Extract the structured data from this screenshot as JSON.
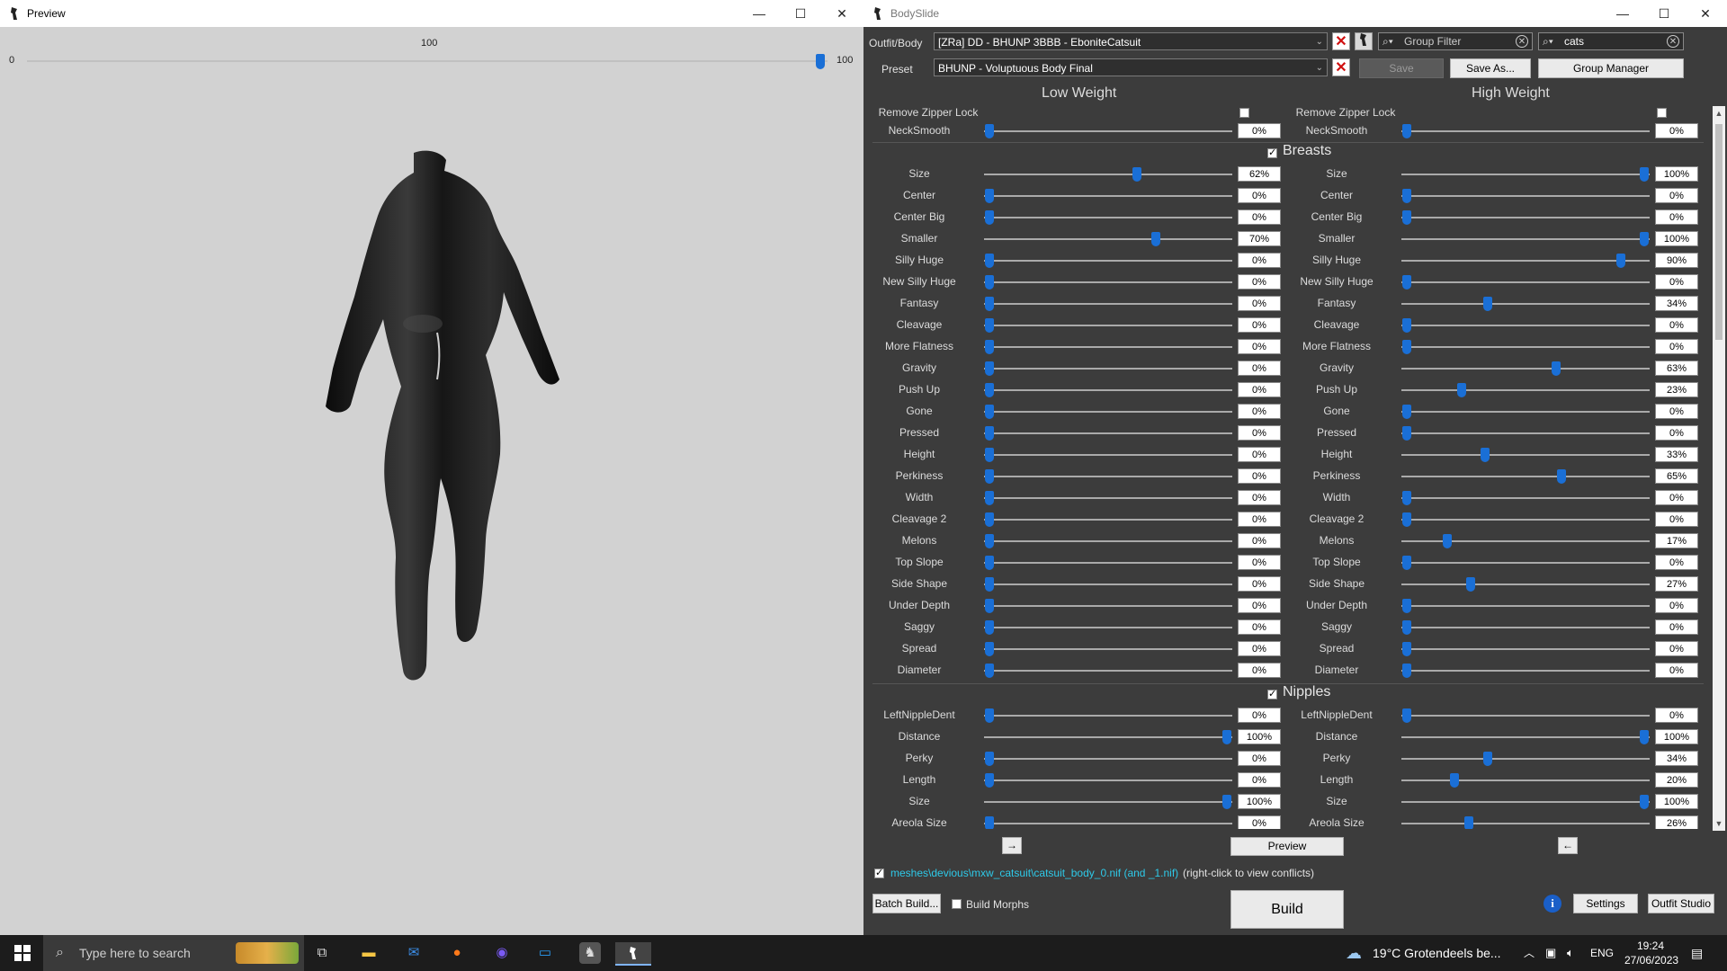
{
  "preview": {
    "title": "Preview",
    "slider_value": "100",
    "slider_min": "0",
    "slider_max": "100",
    "slider_fraction": 1.0
  },
  "bodyslide": {
    "title": "BodySlide",
    "outfit_label": "Outfit/Body",
    "outfit_value": "[ZRa] DD - BHUNP 3BBB - EboniteCatsuit",
    "preset_label": "Preset",
    "preset_value": "BHUNP - Voluptuous Body Final",
    "group_filter_placeholder": "Group Filter",
    "outfit_filter_value": "cats",
    "save_label": "Save",
    "save_as_label": "Save As...",
    "group_manager_label": "Group Manager",
    "low_weight_label": "Low Weight",
    "high_weight_label": "High Weight",
    "preview_label": "Preview",
    "copy_right_label": "→",
    "copy_left_label": "←",
    "path_text": "meshes\\devious\\mxw_catsuit\\catsuit_body_0.nif (and _1.nif)",
    "path_note": "(right-click to view conflicts)",
    "batch_build_label": "Batch Build...",
    "build_morphs_label": "Build Morphs",
    "build_label": "Build",
    "settings_label": "Settings",
    "outfit_studio_label": "Outfit Studio"
  },
  "zipper": {
    "label": "Remove Zipper Lock",
    "low_checked": false,
    "high_checked": false
  },
  "sliders_pre": [
    {
      "name": "NeckSmooth",
      "low": 0,
      "high": 0
    }
  ],
  "groups": [
    {
      "name": "Breasts",
      "checked": true,
      "sliders": [
        {
          "name": "Size",
          "low": 62,
          "high": 100
        },
        {
          "name": "Center",
          "low": 0,
          "high": 0
        },
        {
          "name": "Center Big",
          "low": 0,
          "high": 0
        },
        {
          "name": "Smaller",
          "low": 70,
          "high": 100
        },
        {
          "name": "Silly Huge",
          "low": 0,
          "high": 90
        },
        {
          "name": "New Silly Huge",
          "low": 0,
          "high": 0
        },
        {
          "name": "Fantasy",
          "low": 0,
          "high": 34
        },
        {
          "name": "Cleavage",
          "low": 0,
          "high": 0
        },
        {
          "name": "More Flatness",
          "low": 0,
          "high": 0
        },
        {
          "name": "Gravity",
          "low": 0,
          "high": 63
        },
        {
          "name": "Push Up",
          "low": 0,
          "high": 23
        },
        {
          "name": "Gone",
          "low": 0,
          "high": 0
        },
        {
          "name": "Pressed",
          "low": 0,
          "high": 0
        },
        {
          "name": "Height",
          "low": 0,
          "high": 33
        },
        {
          "name": "Perkiness",
          "low": 0,
          "high": 65
        },
        {
          "name": "Width",
          "low": 0,
          "high": 0
        },
        {
          "name": "Cleavage 2",
          "low": 0,
          "high": 0
        },
        {
          "name": "Melons",
          "low": 0,
          "high": 17
        },
        {
          "name": "Top Slope",
          "low": 0,
          "high": 0
        },
        {
          "name": "Side Shape",
          "low": 0,
          "high": 27
        },
        {
          "name": "Under Depth",
          "low": 0,
          "high": 0
        },
        {
          "name": "Saggy",
          "low": 0,
          "high": 0
        },
        {
          "name": "Spread",
          "low": 0,
          "high": 0
        },
        {
          "name": "Diameter",
          "low": 0,
          "high": 0
        }
      ]
    },
    {
      "name": "Nipples",
      "checked": true,
      "sliders": [
        {
          "name": "LeftNippleDent",
          "low": 0,
          "high": 0
        },
        {
          "name": "Distance",
          "low": 100,
          "high": 100
        },
        {
          "name": "Perky",
          "low": 0,
          "high": 34
        },
        {
          "name": "Length",
          "low": 0,
          "high": 20
        },
        {
          "name": "Size",
          "low": 100,
          "high": 100
        },
        {
          "name": "Areola Size",
          "low": 0,
          "high": 26
        }
      ]
    }
  ],
  "taskbar": {
    "search_placeholder": "Type here to search",
    "weather": "19°C  Grotendeels be...",
    "lang": "ENG",
    "time": "19:24",
    "date": "27/06/2023"
  },
  "colors": {
    "accent": "#1a6fd6",
    "path": "#2ec9e8",
    "panel": "#3c3c3c"
  }
}
